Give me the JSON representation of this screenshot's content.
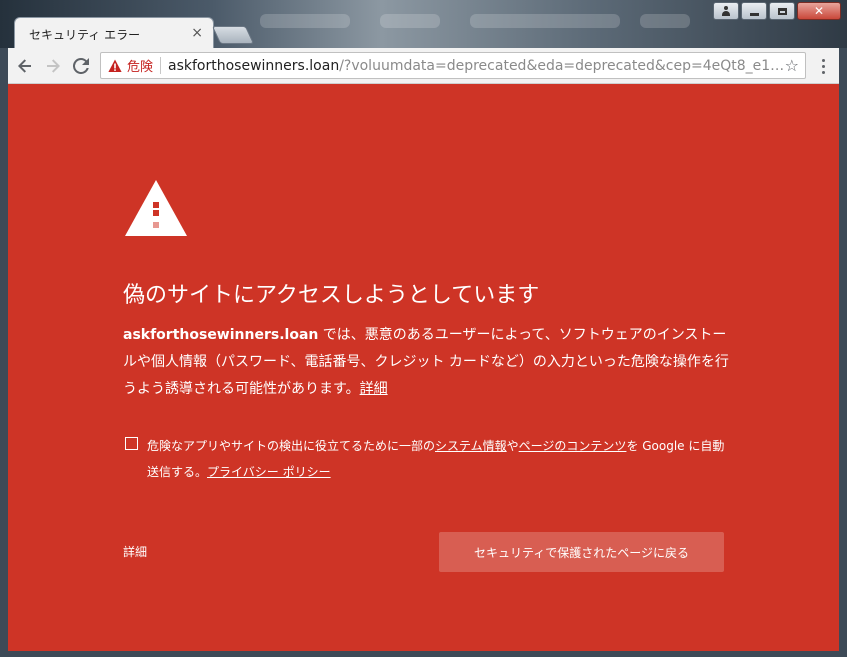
{
  "browser": {
    "tab_title": "セキュリティ エラー",
    "tab_close": "×",
    "url_host": "askforthosewinners.loan",
    "url_rest": "/?voluumdata=deprecated&eda=deprecated&cep=4eQt8_e1…",
    "security_label": "危険"
  },
  "page": {
    "heading": "偽のサイトにアクセスしようとしています",
    "site_name": "askforthosewinners.loan",
    "body_text": " では、悪意のあるユーザーによって、ソフトウェアのインストールや個人情報（パスワード、電話番号、クレジット カードなど）の入力といった危険な操作を行うよう誘導される可能性があります。",
    "learn_more": "詳細",
    "consent_prefix": "危険なアプリやサイトの検出に役立てるために一部の",
    "consent_link1": "システム情報",
    "consent_mid": "や",
    "consent_link2": "ページのコンテンツ",
    "consent_suffix": "を Google に自動送信する。",
    "privacy_policy": "プライバシー ポリシー",
    "details_button": "詳細",
    "back_button": "セキュリティで保護されたページに戻る"
  },
  "colors": {
    "page_background": "#ce3426",
    "back_button": "#d85e52",
    "danger_text": "#c5221f"
  }
}
